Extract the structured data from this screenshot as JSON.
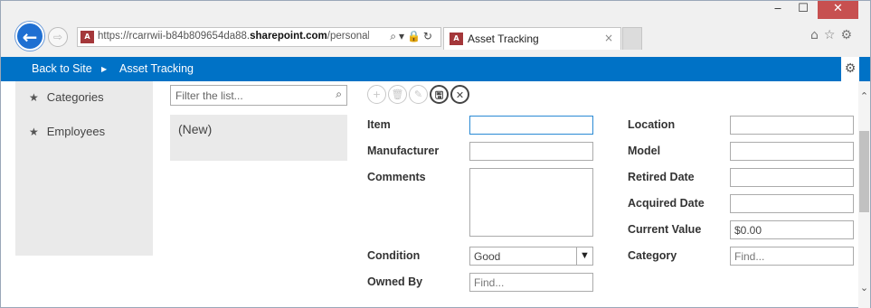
{
  "window": {
    "minimize_glyph": "‒",
    "maximize_glyph": "☐",
    "close_glyph": "✕"
  },
  "browser": {
    "back_glyph": "←",
    "forward_glyph": "⇨",
    "url_prefix": "https://rcarrwii-b84b809654da88.",
    "url_domain": "sharepoint.com",
    "url_suffix": "/personal/rc",
    "address_tools": "⌕▾🔒↻",
    "site_icon_text": "A",
    "tab_title": "Asset Tracking",
    "tab_close": "×",
    "toolbar_icons": "⌂☆⚙"
  },
  "sp_bar": {
    "back_label": "Back to Site",
    "separator": "▶",
    "app_label": "Asset Tracking",
    "gear_glyph": "⚙"
  },
  "nav": {
    "items": [
      {
        "label": "Categories",
        "icon": "star-icon"
      },
      {
        "label": "Employees",
        "icon": "star-icon"
      }
    ]
  },
  "list": {
    "filter_placeholder": "Filter the list...",
    "search_glyph": "⌕",
    "items": [
      "(New)"
    ]
  },
  "actions": {
    "add": "+",
    "delete": "🗑",
    "edit": "✎",
    "save": "🖫",
    "cancel": "✕"
  },
  "form": {
    "item_label": "Item",
    "item_value": "",
    "manufacturer_label": "Manufacturer",
    "manufacturer_value": "",
    "comments_label": "Comments",
    "condition_label": "Condition",
    "condition_value": "Good",
    "owned_by_label": "Owned By",
    "owned_by_placeholder": "Find...",
    "location_label": "Location",
    "model_label": "Model",
    "retired_date_label": "Retired Date",
    "acquired_date_label": "Acquired Date",
    "current_value_label": "Current Value",
    "current_value": "$0.00",
    "category_label": "Category",
    "category_placeholder": "Find..."
  },
  "scroll": {
    "up_glyph": "⌃",
    "down_glyph": "⌄"
  }
}
